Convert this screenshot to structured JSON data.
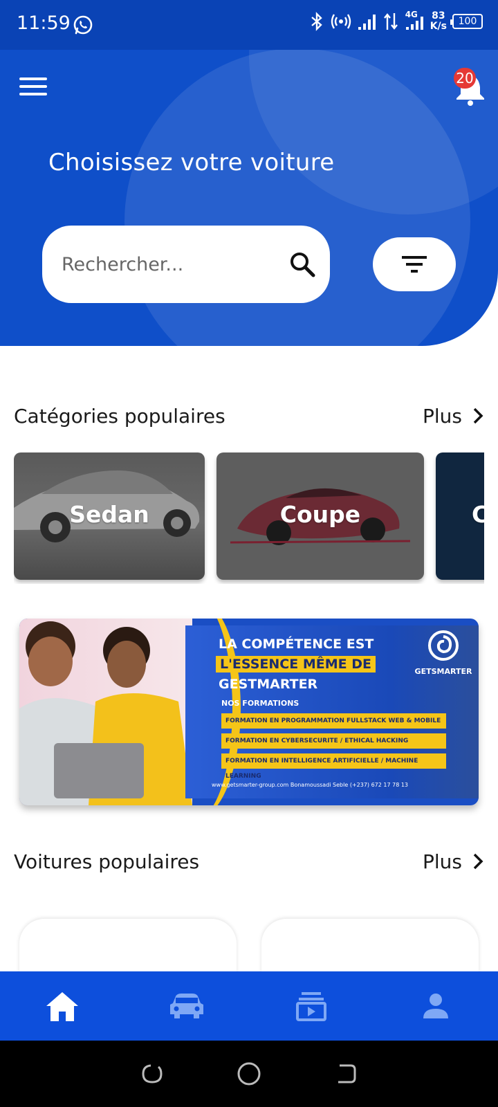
{
  "status_bar": {
    "time": "11:59",
    "speed_value": "83",
    "speed_unit": "K/s",
    "network_type": "4G",
    "battery": "100"
  },
  "header": {
    "notification_count": "20",
    "title": "Choisissez votre voiture",
    "search_placeholder": "Rechercher..."
  },
  "categories_section": {
    "title": "Catégories populaires",
    "more_label": "Plus",
    "items": [
      {
        "label": "Sedan"
      },
      {
        "label": "Coupe"
      },
      {
        "label": "C"
      }
    ]
  },
  "banner": {
    "line1": "LA COMPÉTENCE EST",
    "line2": "L'ESSENCE MÊME DE",
    "line3": "GESTMARTER",
    "subtitle": "NOS FORMATIONS",
    "items": [
      "FORMATION EN PROGRAMMATION FULLSTACK WEB & MOBILE",
      "FORMATION EN CYBERSECURITE / ETHICAL HACKING",
      "FORMATION EN INTELLIGENCE ARTIFICIELLE / MACHINE LEARNING"
    ],
    "logo_text": "GETSMARTER",
    "footer": "www.getsmarter-group.com    Bonamoussadi Seble    (+237) 672 17 78 13"
  },
  "cars_section": {
    "title": "Voitures populaires",
    "more_label": "Plus"
  },
  "bottom_nav": {
    "items": [
      {
        "icon": "home-icon",
        "active": true
      },
      {
        "icon": "car-icon",
        "active": false
      },
      {
        "icon": "video-library-icon",
        "active": false
      },
      {
        "icon": "profile-icon",
        "active": false
      }
    ]
  },
  "colors": {
    "header_blue": "#0f4fc9",
    "nav_blue": "#0d4fdc",
    "badge_red": "#e53935",
    "banner_yellow": "#f5c518"
  }
}
